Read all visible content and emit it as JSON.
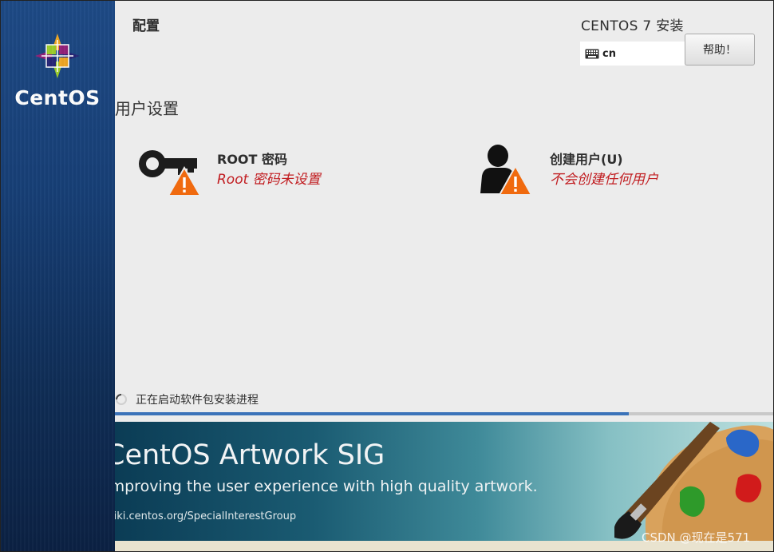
{
  "sidebar": {
    "logo_text": "CentOS"
  },
  "header": {
    "config_title": "配置",
    "install_title": "CENTOS 7 安装",
    "keyboard_layout": "cn",
    "help_label": "帮助！"
  },
  "user_settings": {
    "section_title": "用户设置",
    "root": {
      "title": "ROOT 密码",
      "status": "Root 密码未设置"
    },
    "user": {
      "title": "创建用户(U)",
      "status": "不会创建任何用户"
    }
  },
  "progress": {
    "text": "正在启动软件包安装进程",
    "fraction": 0.78
  },
  "banner": {
    "title": "CentOS Artwork SIG",
    "subtitle": "Improving the user experience with high quality artwork.",
    "url": "wiki.centos.org/SpecialInterestGroup"
  },
  "watermark": "CSDN @现在是571",
  "colors": {
    "warning_text": "#c11c20",
    "warning_triangle": "#f06a0f",
    "progress": "#3b73b9"
  }
}
